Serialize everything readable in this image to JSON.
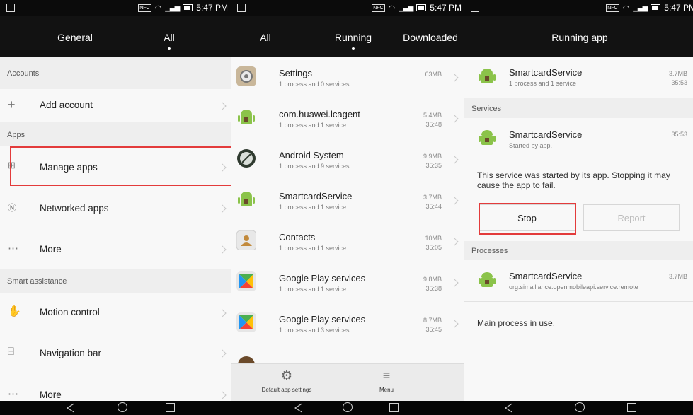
{
  "status_time": "5:47 PM",
  "status_time_short": "5:47 PM",
  "status_nfc": "NFC",
  "panel1": {
    "tabs": [
      "General",
      "All"
    ],
    "sections": {
      "accounts": "Accounts",
      "apps": "Apps",
      "smart": "Smart assistance"
    },
    "items": {
      "add_account": "Add account",
      "manage_apps": "Manage apps",
      "networked_apps": "Networked apps",
      "more1": "More",
      "motion_control": "Motion control",
      "navigation_bar": "Navigation bar",
      "more2": "More"
    }
  },
  "panel2": {
    "tabs": [
      "All",
      "Running",
      "Downloaded"
    ],
    "apps": [
      {
        "name": "Settings",
        "sub": "1 process and 0 services",
        "size": "63MB",
        "time": ""
      },
      {
        "name": "com.huawei.lcagent",
        "sub": "1 process and 1 service",
        "size": "5.4MB",
        "time": "35:48"
      },
      {
        "name": "Android System",
        "sub": "1 process and 9 services",
        "size": "9.9MB",
        "time": "35:35"
      },
      {
        "name": "SmartcardService",
        "sub": "1 process and 1 service",
        "size": "3.7MB",
        "time": "35:44"
      },
      {
        "name": "Contacts",
        "sub": "1 process and 1 service",
        "size": "10MB",
        "time": "35:05"
      },
      {
        "name": "Google Play services",
        "sub": "1 process and 1 service",
        "size": "9.8MB",
        "time": "35:38"
      },
      {
        "name": "Google Play services",
        "sub": "1 process and 3 services",
        "size": "8.7MB",
        "time": "35:45"
      }
    ],
    "bottom": {
      "default_app_settings": "Default app settings",
      "menu": "Menu"
    }
  },
  "panel3": {
    "title": "Running app",
    "app": {
      "name": "SmartcardService",
      "sub": "1 process and 1 service",
      "size": "3.7MB",
      "time": "35:53"
    },
    "services_label": "Services",
    "service": {
      "name": "SmartcardService",
      "sub": "Started by app.",
      "time": "35:53"
    },
    "message": "This service was started by its app. Stopping it may cause the app to fail.",
    "stop": "Stop",
    "report": "Report",
    "processes_label": "Processes",
    "process": {
      "name": "SmartcardService",
      "sub": "org.simalliance.openmobileapi.service:remote",
      "size": "3.7MB"
    },
    "main_process": "Main process in use."
  },
  "colors": {
    "highlight": "#e33b3b",
    "android_green": "#8bc34a"
  }
}
